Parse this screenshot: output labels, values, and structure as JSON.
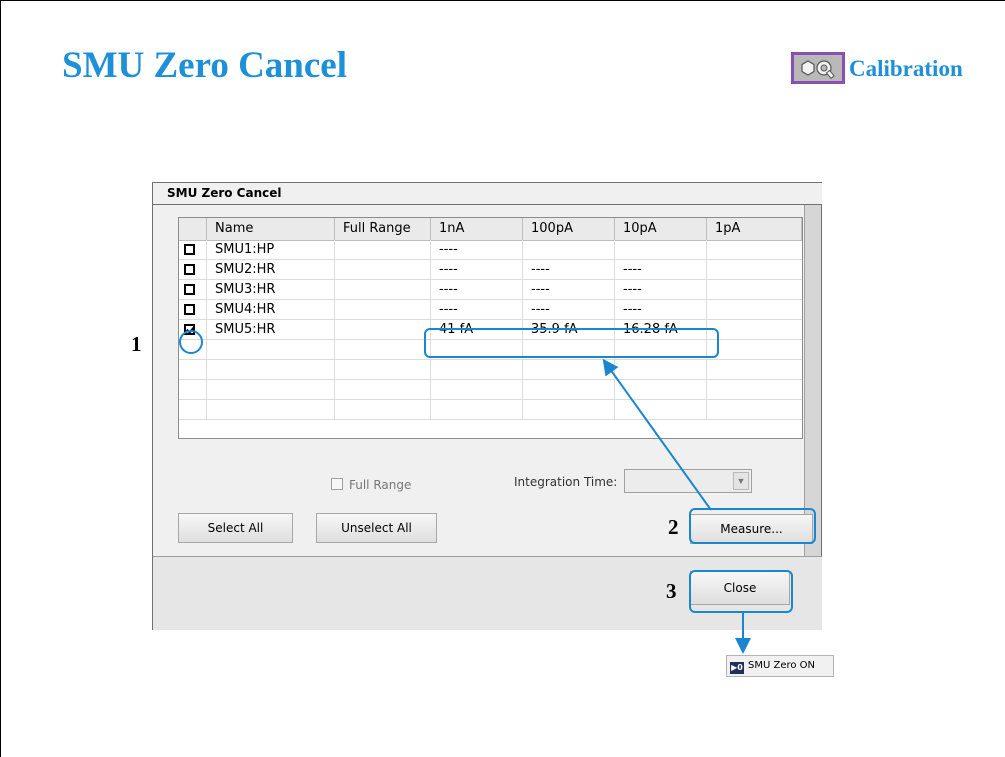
{
  "slide": {
    "title": "SMU Zero Cancel",
    "category_label": "Calibration",
    "steps": [
      "1",
      "2",
      "3"
    ]
  },
  "dialog": {
    "title": "SMU Zero Cancel",
    "columns": [
      "Name",
      "Full Range",
      "1nA",
      "100pA",
      "10pA",
      "1pA"
    ],
    "rows": [
      {
        "checked": false,
        "name": "SMU1:HP",
        "full_range": "",
        "c1nA": "----",
        "c100pA": "",
        "c10pA": "",
        "c1pA": ""
      },
      {
        "checked": false,
        "name": "SMU2:HR",
        "full_range": "",
        "c1nA": "----",
        "c100pA": "----",
        "c10pA": "----",
        "c1pA": ""
      },
      {
        "checked": false,
        "name": "SMU3:HR",
        "full_range": "",
        "c1nA": "----",
        "c100pA": "----",
        "c10pA": "----",
        "c1pA": ""
      },
      {
        "checked": false,
        "name": "SMU4:HR",
        "full_range": "",
        "c1nA": "----",
        "c100pA": "----",
        "c10pA": "----",
        "c1pA": ""
      },
      {
        "checked": true,
        "name": "SMU5:HR",
        "full_range": "",
        "c1nA": "41 fA",
        "c100pA": "35.9 fA",
        "c10pA": "16.28 fA",
        "c1pA": ""
      }
    ],
    "full_range_checkbox": "Full Range",
    "integration_time_label": "Integration Time:",
    "integration_time_value": "",
    "buttons": {
      "select_all": "Select All",
      "unselect_all": "Unselect All",
      "measure": "Measure...",
      "close": "Close"
    }
  },
  "status_indicator": "SMU Zero ON",
  "colors": {
    "title_blue": "#1e90d8",
    "highlight_blue": "#1a86d0",
    "icon_border": "#8a4fb0"
  }
}
